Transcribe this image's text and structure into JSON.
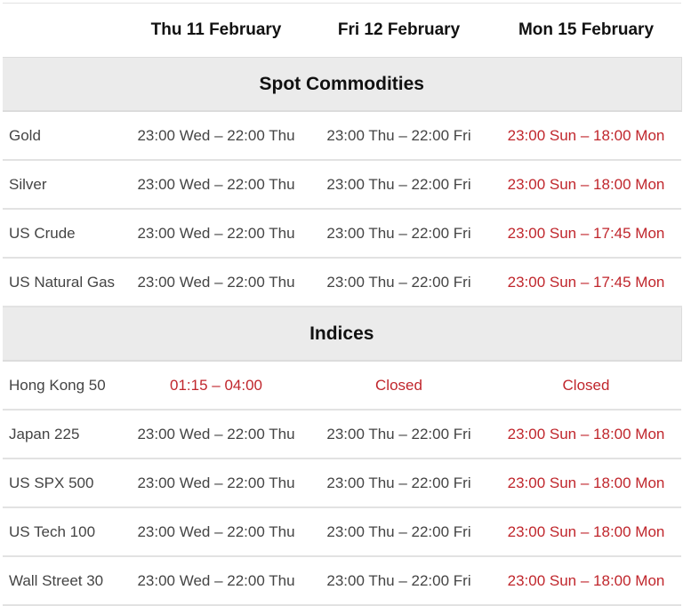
{
  "colors": {
    "accent_red": "#c0262c",
    "text": "#444444",
    "heading": "#111111",
    "section_bg": "#ebebeb",
    "border": "#e2e2e2"
  },
  "header": {
    "columns": [
      "",
      "Thu 11 February",
      "Fri 12 February",
      "Mon 15 February"
    ]
  },
  "sections": [
    {
      "title": "Spot Commodities",
      "rows": [
        {
          "name": "Gold",
          "cells": [
            {
              "text": "23:00 Wed – 22:00 Thu",
              "highlight": false
            },
            {
              "text": "23:00 Thu – 22:00 Fri",
              "highlight": false
            },
            {
              "text": "23:00 Sun – 18:00 Mon",
              "highlight": true
            }
          ]
        },
        {
          "name": "Silver",
          "cells": [
            {
              "text": "23:00 Wed – 22:00 Thu",
              "highlight": false
            },
            {
              "text": "23:00 Thu – 22:00 Fri",
              "highlight": false
            },
            {
              "text": "23:00 Sun – 18:00 Mon",
              "highlight": true
            }
          ]
        },
        {
          "name": "US Crude",
          "cells": [
            {
              "text": "23:00 Wed – 22:00 Thu",
              "highlight": false
            },
            {
              "text": "23:00 Thu – 22:00 Fri",
              "highlight": false
            },
            {
              "text": "23:00 Sun – 17:45 Mon",
              "highlight": true
            }
          ]
        },
        {
          "name": "US Natural Gas",
          "cells": [
            {
              "text": "23:00 Wed – 22:00 Thu",
              "highlight": false
            },
            {
              "text": "23:00 Thu – 22:00 Fri",
              "highlight": false
            },
            {
              "text": "23:00 Sun – 17:45 Mon",
              "highlight": true
            }
          ]
        }
      ]
    },
    {
      "title": "Indices",
      "rows": [
        {
          "name": "Hong Kong 50",
          "cells": [
            {
              "text": "01:15 – 04:00",
              "highlight": true
            },
            {
              "text": "Closed",
              "highlight": true
            },
            {
              "text": "Closed",
              "highlight": true
            }
          ]
        },
        {
          "name": "Japan 225",
          "cells": [
            {
              "text": "23:00 Wed – 22:00 Thu",
              "highlight": false
            },
            {
              "text": "23:00 Thu – 22:00 Fri",
              "highlight": false
            },
            {
              "text": "23:00 Sun – 18:00 Mon",
              "highlight": true
            }
          ]
        },
        {
          "name": "US SPX 500",
          "cells": [
            {
              "text": "23:00 Wed – 22:00 Thu",
              "highlight": false
            },
            {
              "text": "23:00 Thu – 22:00 Fri",
              "highlight": false
            },
            {
              "text": "23:00 Sun – 18:00 Mon",
              "highlight": true
            }
          ]
        },
        {
          "name": "US Tech 100",
          "cells": [
            {
              "text": "23:00 Wed – 22:00 Thu",
              "highlight": false
            },
            {
              "text": "23:00 Thu – 22:00 Fri",
              "highlight": false
            },
            {
              "text": "23:00 Sun – 18:00 Mon",
              "highlight": true
            }
          ]
        },
        {
          "name": "Wall Street 30",
          "cells": [
            {
              "text": "23:00 Wed – 22:00 Thu",
              "highlight": false
            },
            {
              "text": "23:00 Thu – 22:00 Fri",
              "highlight": false
            },
            {
              "text": "23:00 Sun – 18:00 Mon",
              "highlight": true
            }
          ]
        }
      ]
    }
  ]
}
